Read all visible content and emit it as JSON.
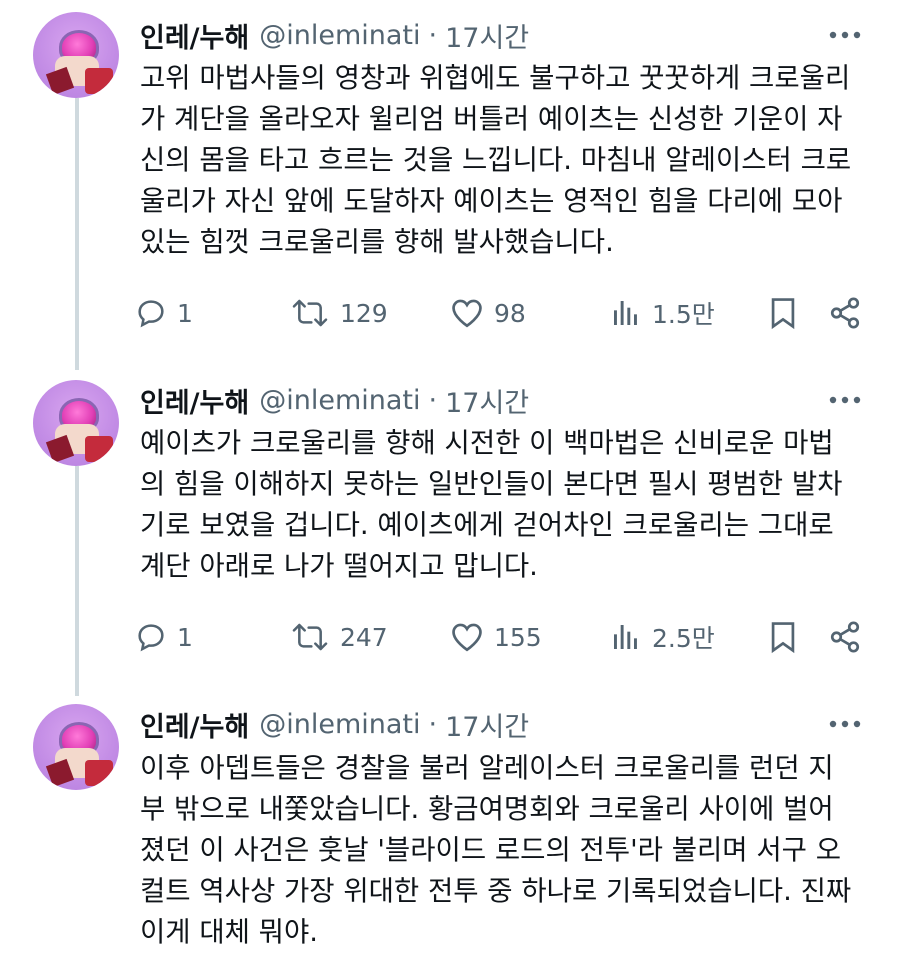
{
  "tweets": [
    {
      "name": "인레/누해",
      "handle": "@inleminati",
      "separator": "·",
      "time": "17시간",
      "text": "고위 마법사들의 영창과 위협에도 불구하고 꿋꿋하게 크로울리\n가 계단을 올라오자 윌리엄 버틀러 예이츠는 신성한 기운이 자\n신의 몸을 타고 흐르는 것을 느낍니다. 마침내 알레이스터 크로\n울리가 자신 앞에 도달하자 예이츠는 영적인 힘을 다리에 모아\n있는 힘껏 크로울리를 향해 발사했습니다.",
      "replies": "1",
      "retweets": "129",
      "likes": "98",
      "views": "1.5만"
    },
    {
      "name": "인레/누해",
      "handle": "@inleminati",
      "separator": "·",
      "time": "17시간",
      "text": "예이츠가 크로울리를 향해 시전한 이 백마법은 신비로운 마법\n의 힘을 이해하지 못하는 일반인들이 본다면 필시 평범한 발차\n기로 보였을 겁니다. 예이츠에게 걷어차인 크로울리는 그대로\n계단 아래로 나가 떨어지고 맙니다.",
      "replies": "1",
      "retweets": "247",
      "likes": "155",
      "views": "2.5만"
    },
    {
      "name": "인레/누해",
      "handle": "@inleminati",
      "separator": "·",
      "time": "17시간",
      "text": "이후 아뎁트들은 경찰을 불러 알레이스터 크로울리를 런던 지\n부 밖으로 내쫓았습니다. 황금여명회와 크로울리 사이에 벌어\n졌던 이 사건은 훗날 '블라이드 로드의 전투'라 불리며 서구 오\n컬트 역사상 가장 위대한 전투 중 하나로 기록되었습니다. 진짜\n이게 대체 뭐야."
    }
  ],
  "icons": {
    "reply": "reply-icon",
    "retweet": "retweet-icon",
    "like": "heart-icon",
    "views": "views-icon",
    "bookmark": "bookmark-icon",
    "share": "share-icon",
    "more": "more-icon"
  }
}
